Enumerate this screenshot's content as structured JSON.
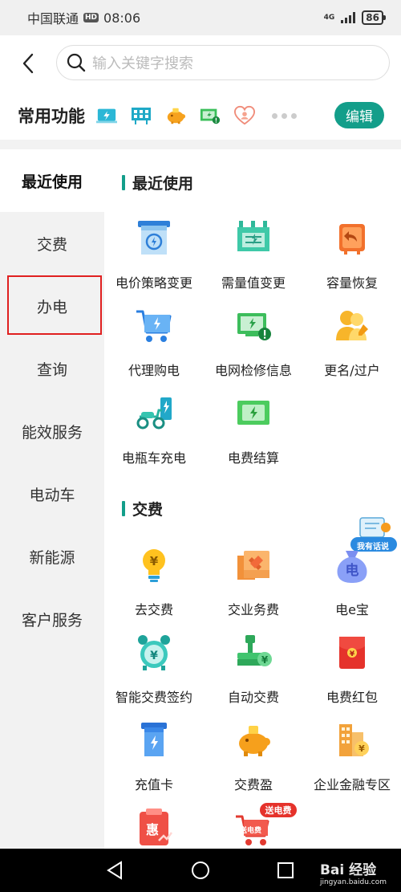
{
  "status_bar": {
    "carrier": "中国联通",
    "hd": "HD",
    "time": "08:06",
    "network": "4G",
    "battery": "86"
  },
  "search": {
    "placeholder": "输入关键字搜索"
  },
  "common": {
    "title": "常用功能",
    "edit_label": "编辑"
  },
  "sidebar": {
    "items": [
      {
        "label": "最近使用"
      },
      {
        "label": "交费"
      },
      {
        "label": "办电"
      },
      {
        "label": "查询"
      },
      {
        "label": "能效服务"
      },
      {
        "label": "电动车"
      },
      {
        "label": "新能源"
      },
      {
        "label": "客户服务"
      }
    ]
  },
  "sections": {
    "recent": {
      "title": "最近使用",
      "items": [
        {
          "label": "电价策略变更",
          "icon": "price-policy-icon"
        },
        {
          "label": "需量值变更",
          "icon": "demand-change-icon"
        },
        {
          "label": "容量恢复",
          "icon": "capacity-restore-icon"
        },
        {
          "label": "代理购电",
          "icon": "proxy-purchase-icon"
        },
        {
          "label": "电网检修信息",
          "icon": "grid-maintenance-icon"
        },
        {
          "label": "更名/过户",
          "icon": "rename-transfer-icon"
        },
        {
          "label": "电瓶车充电",
          "icon": "ebike-charging-icon"
        },
        {
          "label": "电费结算",
          "icon": "bill-settlement-icon"
        }
      ]
    },
    "payment": {
      "title": "交费",
      "items": [
        {
          "label": "去交费",
          "icon": "pay-bulb-icon"
        },
        {
          "label": "交业务费",
          "icon": "business-fee-icon"
        },
        {
          "label": "电e宝",
          "icon": "e-bao-bag-icon"
        },
        {
          "label": "智能交费签约",
          "icon": "smart-pay-clock-icon"
        },
        {
          "label": "自动交费",
          "icon": "auto-pay-icon"
        },
        {
          "label": "电费红包",
          "icon": "red-packet-icon"
        },
        {
          "label": "充值卡",
          "icon": "recharge-card-icon"
        },
        {
          "label": "交费盈",
          "icon": "piggy-bank-icon"
        },
        {
          "label": "企业金融专区",
          "icon": "enterprise-finance-icon"
        },
        {
          "label": "",
          "icon": "discount-icon"
        },
        {
          "label": "",
          "icon": "cart-gift-icon"
        }
      ]
    }
  },
  "badges": {
    "chat": "我有话说",
    "gift": "送电费",
    "gift_small": "送电费"
  },
  "colors": {
    "accent": "#139e8a",
    "highlight": "#e02020"
  },
  "watermark": {
    "brand": "Bai 经验",
    "url": "jingyan.baidu.com"
  }
}
